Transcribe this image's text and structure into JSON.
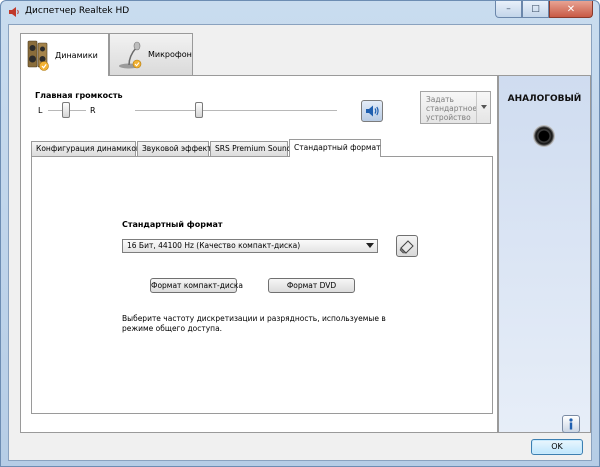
{
  "window": {
    "title": "Диспетчер Realtek HD",
    "controls": {
      "minimize": "–",
      "maximize": "□",
      "close": "✕"
    }
  },
  "device_tabs": [
    {
      "label": "Динамики",
      "icon": "speakers-icon",
      "active": true
    },
    {
      "label": "Микрофон",
      "icon": "microphone-icon",
      "active": false
    }
  ],
  "volume": {
    "label": "Главная громкость",
    "balance_left": "L",
    "balance_right": "R",
    "balance_level": 0.5,
    "main_level": 0.3
  },
  "default_device": {
    "label": "Задать стандартное устройство"
  },
  "side_panel": {
    "label": "АНАЛОГОВЫЙ",
    "jack_icon": "analog-jack-icon"
  },
  "sub_tabs": [
    {
      "label": "Конфигурация динамиков",
      "active": false
    },
    {
      "label": "Звуковой эффект",
      "active": false
    },
    {
      "label": "SRS Premium Sound",
      "active": false
    },
    {
      "label": "Стандартный формат",
      "active": true
    }
  ],
  "format": {
    "label": "Стандартный формат",
    "selected": "16 Бит, 44100 Hz (Качество компакт-диска)",
    "cd_button": "Формат компакт-диска",
    "dvd_button": "Формат DVD",
    "description": "Выберите частоту дискретизации и разрядность, используемые в режиме общего доступа."
  },
  "footer": {
    "info_icon": "info-icon",
    "ok_label": "OK"
  },
  "colors": {
    "frame": "#c3d6ec",
    "accent_blue": "#3c7fb1",
    "panel": "#f0f0f0"
  }
}
